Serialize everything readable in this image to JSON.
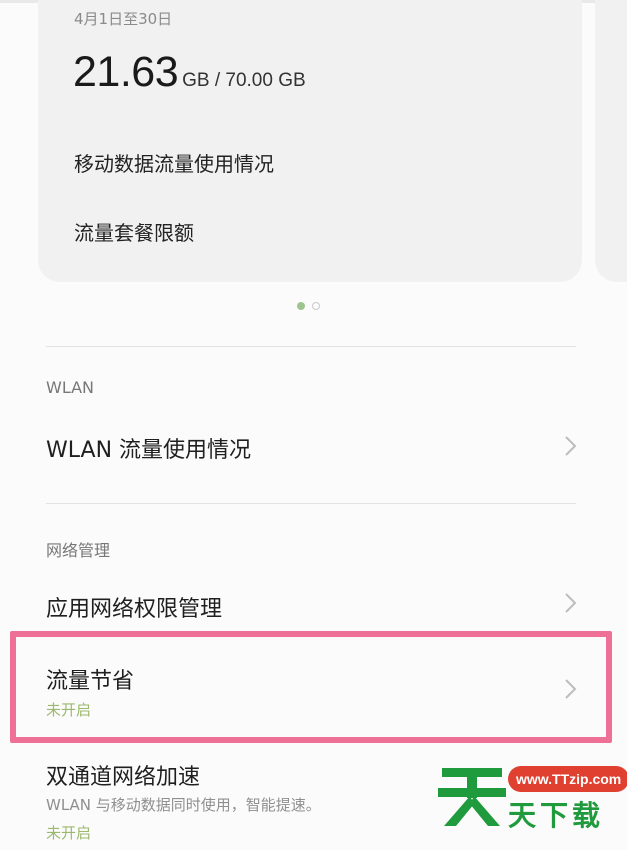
{
  "data_card": {
    "period": "4月1日至30日",
    "used_value": "21.63",
    "used_unit": "GB / 70.00 GB",
    "links": [
      "移动数据流量使用情况",
      "流量套餐限额"
    ]
  },
  "page_indicator": {
    "total": 2,
    "active": 1
  },
  "wlan_section": {
    "header": "WLAN",
    "item_title": "WLAN 流量使用情况"
  },
  "network_section": {
    "header": "网络管理",
    "items": [
      {
        "title": "应用网络权限管理"
      },
      {
        "title": "流量节省",
        "status": "未开启"
      },
      {
        "title": "双通道网络加速",
        "subtitle": "WLAN 与移动数据同时使用，智能提速。",
        "status": "未开启"
      }
    ]
  },
  "watermark": {
    "logo_char": "天",
    "url": "www.TTzip.com",
    "text": "天下载"
  },
  "colors": {
    "highlight": "#ef7096",
    "status_green": "#9bb86e",
    "card_bg": "#f1f1f1",
    "watermark_green": "#1f9a3c",
    "watermark_red": "#e0402f"
  },
  "icons": {
    "chevron": "chevron-right-icon"
  }
}
